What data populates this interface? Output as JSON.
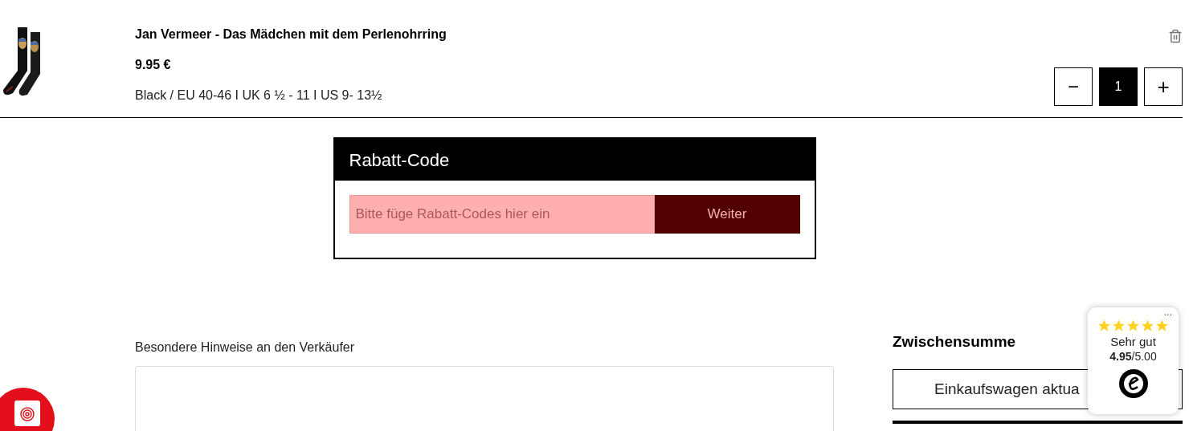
{
  "cart_item": {
    "title": "Jan Vermeer - Das Mädchen mit dem Perlenohrring",
    "price": "9.95 €",
    "variant": "Black / EU 40-46 I UK 6 ½ - 11 I US 9- 13½",
    "quantity": "1",
    "minus": "−",
    "plus": "+"
  },
  "discount": {
    "title": "Rabatt-Code",
    "placeholder": "Bitte füge Rabatt-Codes hier ein",
    "button": "Weiter"
  },
  "notes": {
    "label": "Besondere Hinweise an den Verkäufer"
  },
  "summary": {
    "title": "Zwischensumme",
    "update_button": "Einkaufswagen aktua"
  },
  "trust_badge": {
    "stars": 5,
    "rating_text": "Sehr gut",
    "score": "4.95",
    "max": "/5.00",
    "menu": "..."
  }
}
